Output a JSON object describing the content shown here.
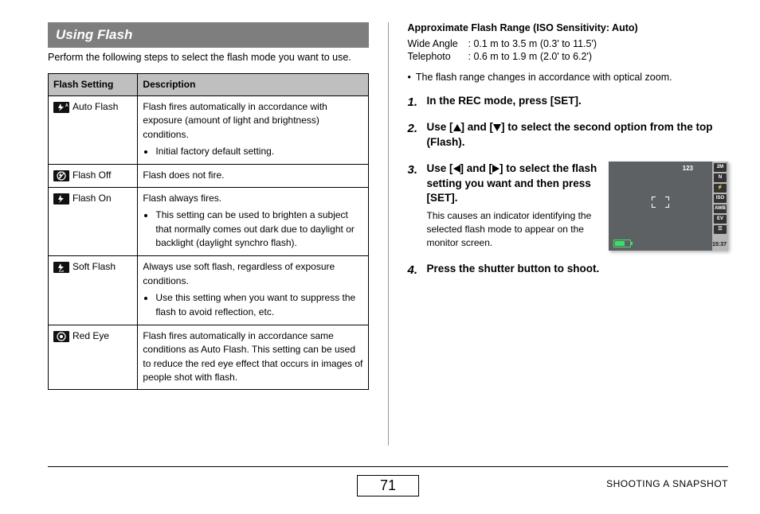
{
  "header": {
    "title": "Using Flash"
  },
  "intro": "Perform the following steps to select the flash mode you want to use.",
  "table": {
    "headers": [
      "Flash Setting",
      "Description"
    ],
    "rows": [
      {
        "icon": "flash-auto",
        "name": "Auto Flash",
        "desc": "Flash fires automatically in accordance with exposure (amount of light and brightness) conditions.",
        "bullets": [
          "Initial factory default setting."
        ]
      },
      {
        "icon": "flash-off",
        "name": "Flash Off",
        "desc": "Flash does not fire.",
        "bullets": []
      },
      {
        "icon": "flash-on",
        "name": "Flash On",
        "desc": "Flash always fires.",
        "bullets": [
          "This setting can be used to brighten a subject that normally comes out dark due to daylight or backlight (daylight synchro flash)."
        ]
      },
      {
        "icon": "flash-soft",
        "name": "Soft Flash",
        "desc": "Always use soft flash, regardless of exposure conditions.",
        "bullets": [
          "Use this setting when you want to suppress the flash to avoid reflection, etc."
        ]
      },
      {
        "icon": "redeye",
        "name": "Red Eye",
        "desc": "Flash fires automatically in accordance same conditions as Auto Flash. This setting can be used to reduce the red eye effect that occurs in images of people shot with flash.",
        "bullets": []
      }
    ]
  },
  "range": {
    "title": "Approximate Flash Range (ISO Sensitivity: Auto)",
    "lines": [
      {
        "label": "Wide Angle",
        "value": "0.1 m to 3.5 m (0.3' to 11.5')"
      },
      {
        "label": "Telephoto",
        "value": "0.6 m to 1.9 m (2.0' to 6.2')"
      }
    ],
    "note": "The flash range changes in accordance with optical zoom."
  },
  "steps": [
    {
      "title_pre": "In the REC mode, press [SET]."
    },
    {
      "title_pre": "Use [",
      "tri1": "up",
      "mid": "] and [",
      "tri2": "down",
      "title_post": "] to select the second option from the top (Flash)."
    },
    {
      "title_pre": "Use [",
      "tri1": "left",
      "mid": "] and [",
      "tri2": "right",
      "title_post": "] to select the flash setting you want and then press [SET].",
      "body": "This causes an indicator identifying the selected flash mode to appear on the monitor screen."
    },
    {
      "title_pre": "Press the shutter button to shoot."
    }
  ],
  "lcd": {
    "count": "123",
    "badges": [
      "2M",
      "N",
      "⚡",
      "ISO",
      "AWB",
      "EV",
      "☰"
    ],
    "time": "15:37"
  },
  "footer": {
    "page": "71",
    "section": "SHOOTING A SNAPSHOT"
  }
}
